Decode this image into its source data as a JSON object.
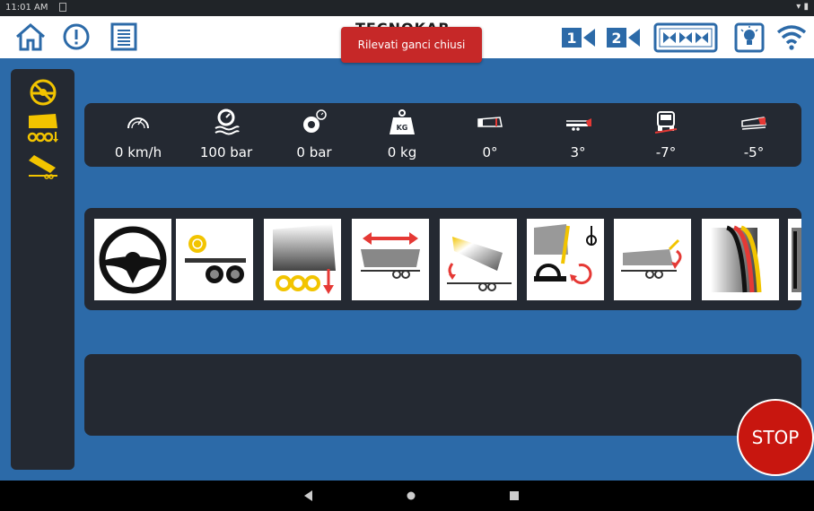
{
  "status_bar": {
    "time": "11:01 AM"
  },
  "header": {
    "title": "TECNOKAR"
  },
  "toast": {
    "message": "Rilevati ganci chiusi"
  },
  "sensors": [
    {
      "name": "speed",
      "value": "0 km/h"
    },
    {
      "name": "hydraulic-pressure",
      "value": "100 bar"
    },
    {
      "name": "tyre-pressure",
      "value": "0 bar"
    },
    {
      "name": "weight",
      "value": "0 kg"
    },
    {
      "name": "body-angle",
      "value": "0°"
    },
    {
      "name": "trailer-pitch",
      "value": "3°"
    },
    {
      "name": "tractor-roll",
      "value": "-7°"
    },
    {
      "name": "trailer-roll",
      "value": "-5°"
    }
  ],
  "weight_icon_label": "KG",
  "function_buttons": [
    "steering",
    "axle-lift",
    "axle-lower",
    "body-slide",
    "body-tilt",
    "hook-coupling",
    "tail-tilt",
    "body-liner"
  ],
  "stop_button": {
    "label": "STOP"
  },
  "colors": {
    "brand_blue": "#2c6aa8",
    "accent_yellow": "#f2c400",
    "alert_red": "#c62828",
    "panel_dark": "#242932"
  }
}
